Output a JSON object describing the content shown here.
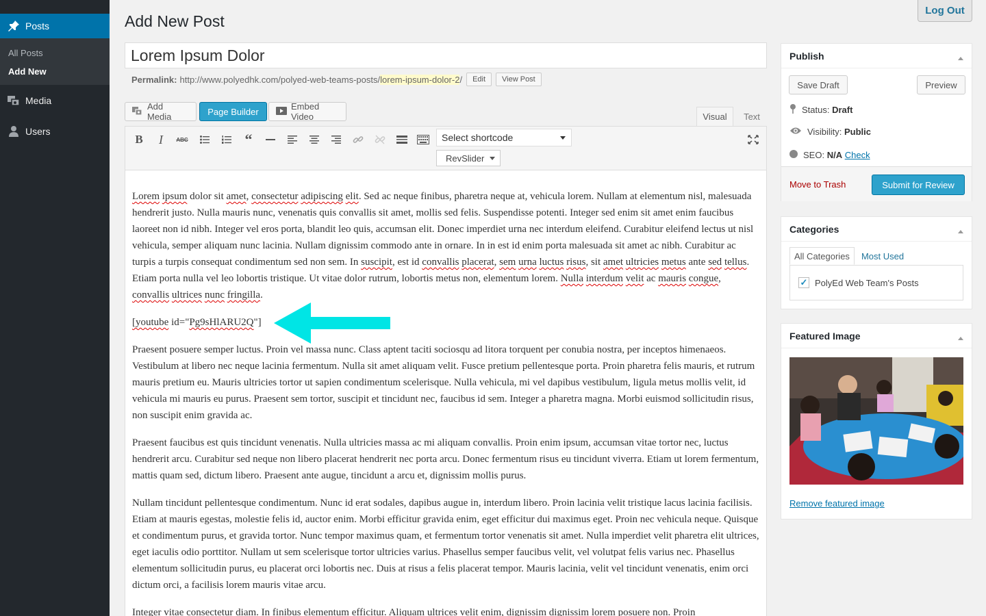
{
  "sidebar": {
    "posts_label": "Posts",
    "submenu": [
      "All Posts",
      "Add New"
    ],
    "media_label": "Media",
    "users_label": "Users"
  },
  "header": {
    "title": "Add New Post",
    "logout": "Log Out"
  },
  "post": {
    "title": "Lorem Ipsum Dolor",
    "permalink_label": "Permalink:",
    "permalink_base": "http://www.polyedhk.com/polyed-web-teams-posts/",
    "permalink_slug": "lorem-ipsum-dolor-2",
    "permalink_end": "/",
    "edit_label": "Edit",
    "view_label": "View Post"
  },
  "media_buttons": {
    "add_media": "Add Media",
    "page_builder": "Page Builder",
    "embed_video": "Embed Video"
  },
  "editor_tabs": {
    "visual": "Visual",
    "text": "Text"
  },
  "toolbar": {
    "shortcode_select": "Select shortcode",
    "revslider": "RevSlider",
    "icons": [
      "bold-icon",
      "italic-icon",
      "strikethrough-icon",
      "bullet-list-icon",
      "numbered-list-icon",
      "blockquote-icon",
      "horizontal-rule-icon",
      "align-left-icon",
      "align-center-icon",
      "align-right-icon",
      "link-icon",
      "unlink-icon",
      "read-more-icon",
      "toolbar-toggle-icon",
      "fullscreen-icon"
    ]
  },
  "content": {
    "p1_parts": [
      [
        "Lorem",
        true
      ],
      [
        " ",
        false
      ],
      [
        "ipsum",
        true
      ],
      [
        " dolor sit ",
        false
      ],
      [
        "amet",
        true
      ],
      [
        ", ",
        false
      ],
      [
        "consectetur",
        true
      ],
      [
        " ",
        false
      ],
      [
        "adipiscing",
        true
      ],
      [
        " ",
        false
      ],
      [
        "elit",
        true
      ],
      [
        ". Sed ac neque finibus, pharetra neque at, vehicula lorem. Nullam at elementum nisl, malesuada hendrerit justo. Nulla mauris nunc, venenatis quis convallis sit amet, mollis sed felis. Suspendisse potenti. Integer sed enim sit amet enim faucibus laoreet non id nibh. Integer vel eros porta, blandit leo quis, accumsan elit. Donec imperdiet urna nec interdum eleifend. Curabitur eleifend lectus ut nisl vehicula, semper aliquam nunc lacinia. Nullam dignissim commodo ante in ornare. In in est id enim porta malesuada sit amet ac nibh. Curabitur ac turpis a turpis consequat condimentum sed non sem. In ",
        false
      ],
      [
        "suscipit",
        true
      ],
      [
        ", est id ",
        false
      ],
      [
        "convallis",
        true
      ],
      [
        " ",
        false
      ],
      [
        "placerat",
        true
      ],
      [
        ", ",
        false
      ],
      [
        "sem",
        true
      ],
      [
        " ",
        false
      ],
      [
        "urna",
        true
      ],
      [
        " ",
        false
      ],
      [
        "luctus",
        true
      ],
      [
        " ",
        false
      ],
      [
        "risus",
        true
      ],
      [
        ", sit ",
        false
      ],
      [
        "amet",
        true
      ],
      [
        " ",
        false
      ],
      [
        "ultricies",
        true
      ],
      [
        " ",
        false
      ],
      [
        "metus",
        true
      ],
      [
        " ante ",
        false
      ],
      [
        "sed",
        true
      ],
      [
        " ",
        false
      ],
      [
        "tellus",
        true
      ],
      [
        ". Etiam porta nulla vel leo lobortis tristique. Ut vitae dolor rutrum, lobortis metus non, elementum lorem. ",
        false
      ],
      [
        "Nulla",
        true
      ],
      [
        " ",
        false
      ],
      [
        "interdum",
        true
      ],
      [
        " ",
        false
      ],
      [
        "velit",
        true
      ],
      [
        " ac ",
        false
      ],
      [
        "mauris",
        true
      ],
      [
        " ",
        false
      ],
      [
        "congue",
        true
      ],
      [
        ", ",
        false
      ],
      [
        "convallis",
        true
      ],
      [
        " ",
        false
      ],
      [
        "ultrices",
        true
      ],
      [
        " ",
        false
      ],
      [
        "nunc",
        true
      ],
      [
        " ",
        false
      ],
      [
        "fringilla",
        true
      ],
      [
        ".",
        false
      ]
    ],
    "shortcode_parts": [
      [
        "[youtube",
        true
      ],
      [
        " id=\"",
        false
      ],
      [
        "Pg9sHlARU2Q",
        true
      ],
      [
        "\"]",
        false
      ]
    ],
    "p2": "Praesent posuere semper luctus. Proin vel massa nunc. Class aptent taciti sociosqu ad litora torquent per conubia nostra, per inceptos himenaeos. Vestibulum at libero nec neque lacinia fermentum. Nulla sit amet aliquam velit. Fusce pretium pellentesque porta. Proin pharetra felis mauris, et rutrum mauris pretium eu. Mauris ultricies tortor ut sapien condimentum scelerisque. Nulla vehicula, mi vel dapibus vestibulum, ligula metus mollis velit, id vehicula mi mauris eu purus. Praesent sem tortor, suscipit et tincidunt nec, faucibus id sem. Integer a pharetra magna. Morbi euismod sollicitudin risus, non suscipit enim gravida ac.",
    "p3": "Praesent faucibus est quis tincidunt venenatis. Nulla ultricies massa ac mi aliquam convallis. Proin enim ipsum, accumsan vitae tortor nec, luctus hendrerit arcu. Curabitur sed neque non libero placerat hendrerit nec porta arcu. Donec fermentum risus eu tincidunt viverra. Etiam ut lorem fermentum, mattis quam sed, dictum libero. Praesent ante augue, tincidunt a arcu et, dignissim mollis purus.",
    "p4": "Nullam tincidunt pellentesque condimentum. Nunc id erat sodales, dapibus augue in, interdum libero. Proin lacinia velit tristique lacus lacinia facilisis. Etiam at mauris egestas, molestie felis id, auctor enim. Morbi efficitur gravida enim, eget efficitur dui maximus eget. Proin nec vehicula neque. Quisque et condimentum purus, et gravida tortor. Nunc tempor maximus quam, et fermentum tortor venenatis sit amet. Nulla imperdiet velit pharetra elit ultrices, eget iaculis odio porttitor. Nullam ut sem scelerisque tortor ultricies varius. Phasellus semper faucibus velit, vel volutpat felis varius nec. Phasellus elementum sollicitudin purus, eu placerat orci lobortis nec. Duis at risus a felis placerat tempor. Mauris lacinia, velit vel tincidunt venenatis, enim orci dictum orci, a facilisis lorem mauris vitae arcu.",
    "p5": "Integer vitae consectetur diam. In finibus elementum efficitur. Aliquam ultrices velit enim, dignissim dignissim lorem posuere non. Proin"
  },
  "publish": {
    "title": "Publish",
    "save_draft": "Save Draft",
    "preview": "Preview",
    "status_label": "Status:",
    "status_value": "Draft",
    "visibility_label": "Visibility:",
    "visibility_value": "Public",
    "seo_label": "SEO:",
    "seo_value": "N/A",
    "seo_check": "Check",
    "trash": "Move to Trash",
    "submit": "Submit for Review"
  },
  "categories": {
    "title": "Categories",
    "tab_all": "All Categories",
    "tab_used": "Most Used",
    "items": [
      {
        "label": "PolyEd Web Team's Posts",
        "checked": true
      }
    ]
  },
  "featured_image": {
    "title": "Featured Image",
    "remove": "Remove featured image"
  },
  "colors": {
    "accent": "#2ea2cc",
    "sidebar_bg": "#23282d",
    "active_menu": "#0073aa",
    "annotation_arrow": "#00e5e5",
    "trash": "#aa0000"
  }
}
